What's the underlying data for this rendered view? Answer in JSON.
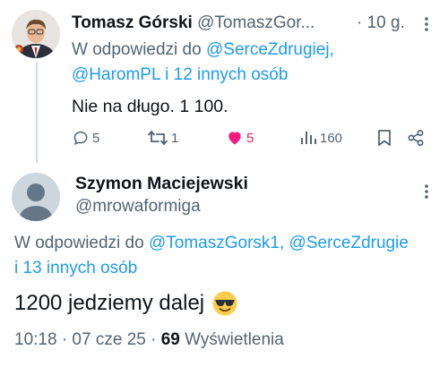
{
  "tweet1": {
    "author_name": "Tomasz Górski",
    "author_handle": "@TomaszGor...",
    "time": "· 10 g.",
    "reply_prefix": "W odpowiedzi do",
    "reply_link1": "@SerceZdrugiej,",
    "reply_link2": "@HaromPL",
    "reply_suffix": "i 12 innych osób",
    "text": "Nie na długo. 1 100.",
    "replies": "5",
    "retweets": "1",
    "likes": "5",
    "views": "160",
    "like_color": "#e0245e"
  },
  "tweet2": {
    "author_name": "Szymon Maciejewski",
    "author_handle": "@mrowaformiga",
    "reply_prefix": "W odpowiedzi do",
    "reply_link1": "@TomaszGorsk1,",
    "reply_link2": "@SerceZdrugie",
    "reply_suffix": "i 13 innych osób",
    "text": "1200 jedziemy dalej",
    "emoji_name": "sunglasses-emoji",
    "time_date": "10:18 · 07 cze 25 ·",
    "view_count": "69",
    "view_label": "Wyświetlenia"
  },
  "colors": {
    "link": "#1d9bf0",
    "secondary_text": "#536471",
    "primary_text": "#0f1419"
  }
}
